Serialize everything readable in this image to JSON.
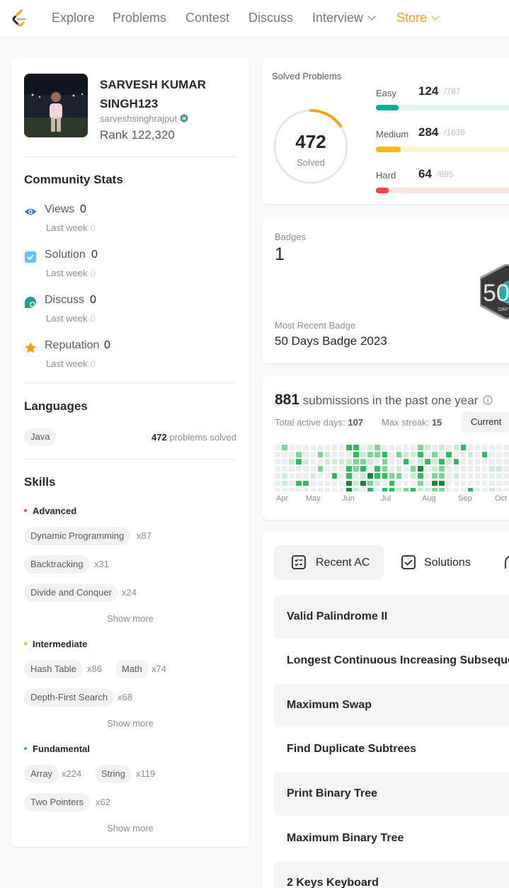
{
  "nav": {
    "items": [
      "Explore",
      "Problems",
      "Contest",
      "Discuss",
      "Interview",
      "Store"
    ]
  },
  "profile": {
    "name": "SARVESH KUMAR SINGH123",
    "username": "sarveshsinghrajput",
    "rank_label": "Rank",
    "rank": "122,320"
  },
  "community": {
    "title": "Community Stats",
    "stats": [
      {
        "label": "Views",
        "value": "0",
        "lw_label": "Last week",
        "lw": "0",
        "icon": "eye-icon"
      },
      {
        "label": "Solution",
        "value": "0",
        "lw_label": "Last week",
        "lw": "0",
        "icon": "check-square-icon"
      },
      {
        "label": "Discuss",
        "value": "0",
        "lw_label": "Last week",
        "lw": "0",
        "icon": "chat-bubble-icon"
      },
      {
        "label": "Reputation",
        "value": "0",
        "lw_label": "Last week",
        "lw": "0",
        "icon": "star-icon"
      }
    ]
  },
  "languages": {
    "title": "Languages",
    "items": [
      {
        "name": "Java",
        "count": "472",
        "suffix": "problems solved"
      }
    ]
  },
  "skills": {
    "title": "Skills",
    "show_more": "Show more",
    "groups": [
      {
        "level": "Advanced",
        "color": "#ef4743",
        "tags": [
          [
            "Dynamic Programming",
            "x87"
          ],
          [
            "Backtracking",
            "x31"
          ],
          [
            "Divide and Conquer",
            "x24"
          ]
        ]
      },
      {
        "level": "Intermediate",
        "color": "#ffb800",
        "tags": [
          [
            "Hash Table",
            "x86"
          ],
          [
            "Math",
            "x74"
          ],
          [
            "Depth-First Search",
            "x68"
          ]
        ]
      },
      {
        "level": "Fundamental",
        "color": "#2cbb5d",
        "tags": [
          [
            "Array",
            "x224"
          ],
          [
            "String",
            "x119"
          ],
          [
            "Two Pointers",
            "x62"
          ]
        ]
      }
    ]
  },
  "solved": {
    "title": "Solved Problems",
    "total": "472",
    "total_label": "Solved",
    "ring_fraction": 0.153,
    "difficulties": [
      {
        "label": "Easy",
        "solved": "124",
        "total": "/787",
        "fraction": 0.158,
        "color": "#00af9b",
        "track": "#e0f4ef"
      },
      {
        "label": "Medium",
        "solved": "284",
        "total": "/1636",
        "fraction": 0.174,
        "color": "#ffb800",
        "track": "#fff3d6"
      },
      {
        "label": "Hard",
        "solved": "64",
        "total": "/695",
        "fraction": 0.092,
        "color": "#ef4743",
        "track": "#fde3e2"
      }
    ]
  },
  "badges": {
    "title": "Badges",
    "count": "1",
    "recent_label": "Most Recent Badge",
    "recent": "50 Days Badge 2023",
    "badge_text": "50",
    "badge_sub": "DAY"
  },
  "submissions": {
    "count": "881",
    "label": "submissions in the past one year",
    "active_label": "Total active days:",
    "active": "107",
    "streak_label": "Max streak:",
    "streak": "15",
    "current_label": "Current",
    "months": [
      "Apr",
      "May",
      "Jun",
      "Jul",
      "Aug",
      "Sep",
      "Oct"
    ]
  },
  "recent": {
    "tabs": [
      "Recent AC",
      "Solutions"
    ],
    "items": [
      "Valid Palindrome II",
      "Longest Continuous Increasing Subsequence",
      "Maximum Swap",
      "Find Duplicate Subtrees",
      "Print Binary Tree",
      "Maximum Binary Tree",
      "2 Keys Keyboard"
    ]
  }
}
